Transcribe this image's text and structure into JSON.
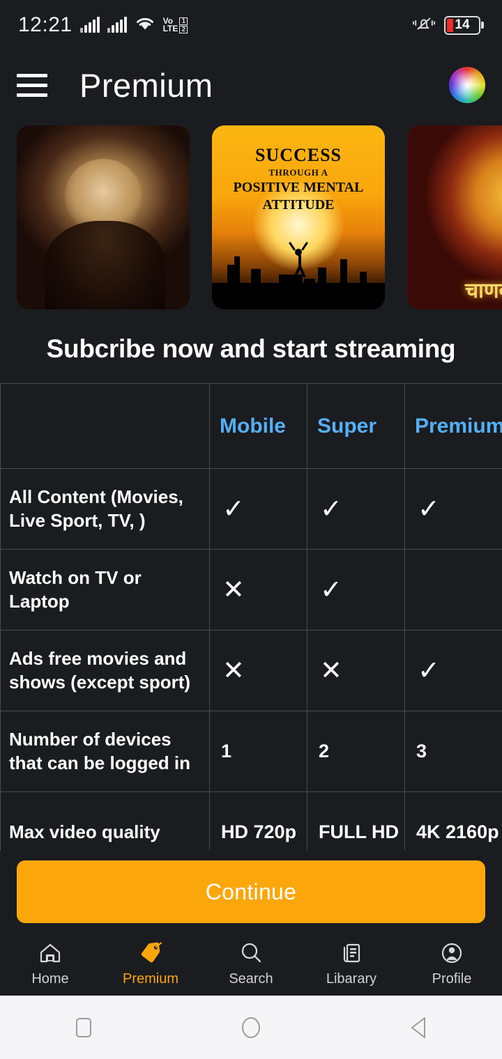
{
  "statusbar": {
    "time": "12:21",
    "network_label_top": "Vo",
    "network_label_bottom": "LTE",
    "sim1": "1",
    "sim2": "2",
    "battery_percent": "14",
    "icons": [
      "signal-bars-icon",
      "signal-bars-icon",
      "wifi-icon",
      "volte-icon",
      "vibrate-icon",
      "battery-icon"
    ]
  },
  "appbar": {
    "menu_icon": "hamburger-menu-icon",
    "title": "Premium",
    "avatar_icon": "color-wheel-icon"
  },
  "carousel": {
    "cards": [
      {
        "name": "portrait-painting-card",
        "caption": ""
      },
      {
        "name": "success-book-card",
        "line1": "SUCCESS",
        "line2": "THROUGH A",
        "line3": "POSITIVE MENTAL",
        "line4": "ATTITUDE"
      },
      {
        "name": "chanakya-card",
        "caption": "चाणक्य"
      }
    ]
  },
  "section": {
    "title": "Subcribe now and start streaming"
  },
  "pricing": {
    "columns": [
      "",
      "Mobile",
      "Super",
      "Premium"
    ],
    "rows": [
      {
        "feature": "All Content (Movies, Live Sport, TV, )",
        "mobile": "✓",
        "super": "✓",
        "premium": "✓"
      },
      {
        "feature": "Watch on TV or Laptop",
        "mobile": "✕",
        "super": "✓",
        "premium": ""
      },
      {
        "feature": "Ads free movies and shows (except sport)",
        "mobile": "✕",
        "super": "✕",
        "premium": "✓"
      },
      {
        "feature": "Number of devices that can be logged in",
        "mobile": "1",
        "super": "2",
        "premium": "3"
      },
      {
        "feature": "Max video quality",
        "mobile": "HD 720p",
        "super": "FULL HD",
        "premium": "4K 2160p"
      }
    ]
  },
  "cta": {
    "label": "Continue"
  },
  "bottomnav": {
    "items": [
      {
        "label": "Home",
        "icon": "home-icon",
        "active": false
      },
      {
        "label": "Premium",
        "icon": "price-tag-icon",
        "active": true
      },
      {
        "label": "Search",
        "icon": "search-icon",
        "active": false
      },
      {
        "label": "Libarary",
        "icon": "library-icon",
        "active": false
      },
      {
        "label": "Profile",
        "icon": "profile-icon",
        "active": false
      }
    ]
  },
  "sysnav": {
    "recents": "recents-square-icon",
    "home": "home-circle-icon",
    "back": "back-triangle-icon"
  },
  "colors": {
    "background": "#1b1c20",
    "accent": "#fba60a",
    "plan_blue": "#54aff5",
    "battery_red": "#ea2d2d",
    "table_border": "#4a4c52"
  }
}
